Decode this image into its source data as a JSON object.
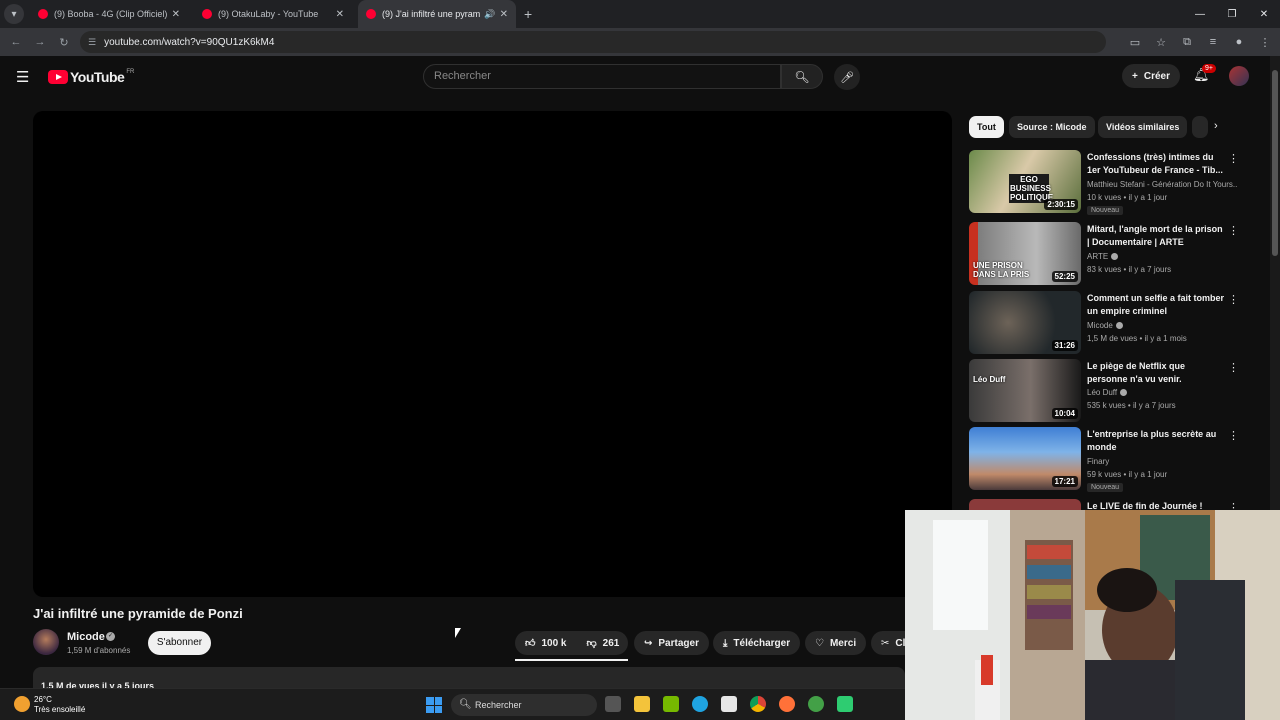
{
  "browser": {
    "tabs": [
      {
        "label": "(9) Booba - 4G (Clip Officiel) - Y",
        "active": false
      },
      {
        "label": "(9) OtakuLaby - YouTube",
        "active": false
      },
      {
        "label": "(9) J'ai infiltré une pyramide",
        "active": true
      }
    ],
    "url": "youtube.com/watch?v=90QU1zK6kM4"
  },
  "yt": {
    "logo_text": "YouTube",
    "country": "FR",
    "search_placeholder": "Rechercher",
    "create_label": "Créer",
    "notif_badge": "9+"
  },
  "video": {
    "title": "J'ai infiltré une pyramide de Ponzi",
    "channel": "Micode",
    "subscribers": "1,59 M d'abonnés",
    "subscribe_label": "S'abonner",
    "likes": "100 k",
    "dislikes": "261",
    "share_label": "Partager",
    "download_label": "Télécharger",
    "thanks_label": "Merci",
    "clip_label": "Cl",
    "meta": "1,5 M de vues  il y a 5 jours"
  },
  "chips": [
    "Tout",
    "Source : Micode",
    "Vidéos similaires"
  ],
  "recommendations": [
    {
      "title": "Confessions (très) intimes du 1er YouTubeur de France - Tib...",
      "channel": "Matthieu Stefani - Génération Do It Yours...",
      "stats": "10 k vues • il y a 1 jour",
      "badge": "Nouveau",
      "duration": "2:30:15",
      "overlay": "EGO BUSINESS POLITIQUE",
      "verified": false
    },
    {
      "title": "Mitard, l'angle mort de la prison | Documentaire | ARTE",
      "channel": "ARTE",
      "stats": "83 k vues • il y a 7 jours",
      "badge": "",
      "duration": "52:25",
      "overlay": "UNE PRISON DANS LA PRIS",
      "verified": true
    },
    {
      "title": "Comment un selfie a fait tomber un empire criminel",
      "channel": "Micode",
      "stats": "1,5 M de vues • il y a 1 mois",
      "badge": "",
      "duration": "31:26",
      "overlay": "",
      "verified": true
    },
    {
      "title": "Le piège de Netflix que personne n'a vu venir.",
      "channel": "Léo Duff",
      "stats": "535 k vues • il y a 7 jours",
      "badge": "",
      "duration": "10:04",
      "overlay": "Léo Duff",
      "verified": true
    },
    {
      "title": "L'entreprise la plus secrète au monde",
      "channel": "Finary",
      "stats": "59 k vues • il y a 1 jour",
      "badge": "Nouveau",
      "duration": "17:21",
      "overlay": "",
      "verified": false
    },
    {
      "title": "Le LIVE de fin de Journée !",
      "channel": "",
      "stats": "",
      "badge": "",
      "duration": "",
      "overlay": "",
      "verified": false
    }
  ],
  "taskbar": {
    "temp": "26°C",
    "weather": "Très ensoleillé",
    "search_label": "Rechercher"
  },
  "icons": {
    "menu": "hamburger-icon",
    "search": "search-icon",
    "mic": "mic-icon",
    "bell": "bell-icon",
    "like": "thumbs-up-icon",
    "dislike": "thumbs-down-icon",
    "share": "share-icon",
    "download": "download-icon"
  },
  "colors": {
    "accent": "#ff0033",
    "background": "#0f0f0f",
    "surface": "#272727"
  }
}
